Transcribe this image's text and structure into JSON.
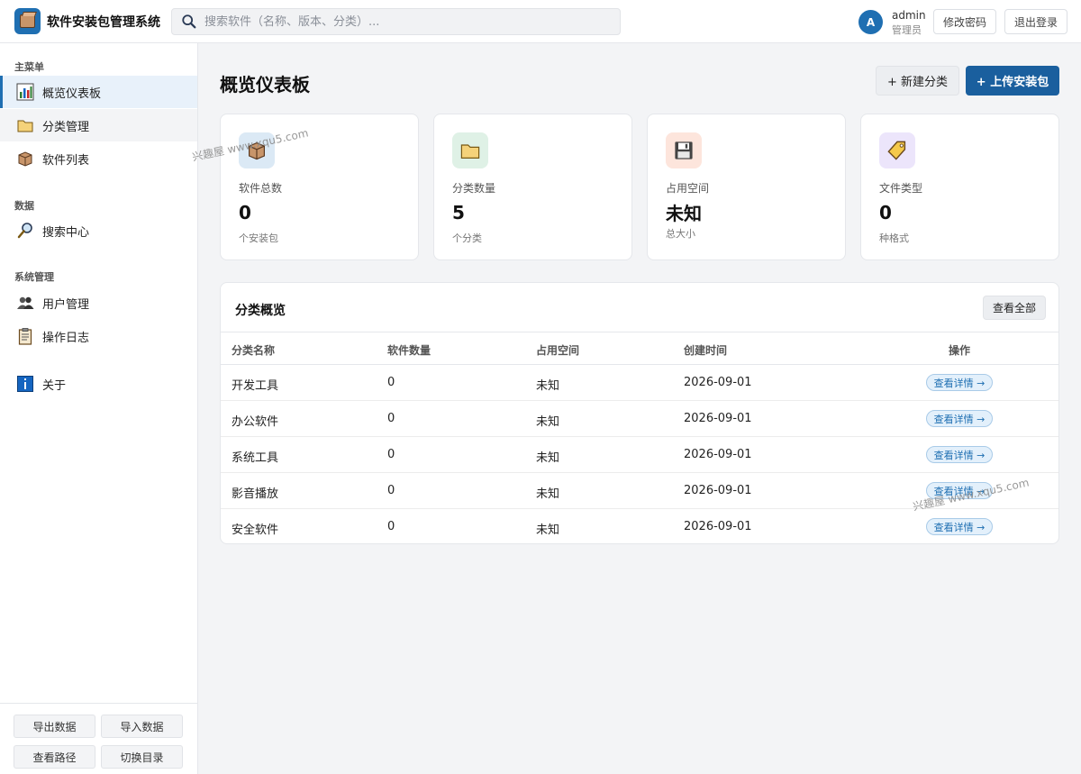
{
  "header": {
    "app_title": "软件安装包管理系统",
    "search_placeholder": "搜索软件（名称、版本、分类）...",
    "avatar_letter": "A",
    "user_name": "admin",
    "user_role": "管理员",
    "change_password": "修改密码",
    "logout": "退出登录"
  },
  "sidebar": {
    "sections": [
      {
        "title": "主菜单",
        "items": [
          {
            "label": "概览仪表板",
            "icon": "chart-icon",
            "active": true
          },
          {
            "label": "分类管理",
            "icon": "folder-icon"
          },
          {
            "label": "软件列表",
            "icon": "package-icon"
          }
        ]
      },
      {
        "title": "数据",
        "items": [
          {
            "label": "搜索中心",
            "icon": "magnifier-icon"
          }
        ]
      },
      {
        "title": "系统管理",
        "items": [
          {
            "label": "用户管理",
            "icon": "users-icon"
          },
          {
            "label": "操作日志",
            "icon": "clipboard-icon"
          },
          {
            "label": "关于",
            "icon": "info-icon"
          }
        ]
      }
    ],
    "footer": {
      "export": "导出数据",
      "import": "导入数据",
      "view_path": "查看路径",
      "switch_dir": "切换目录"
    }
  },
  "main": {
    "title": "概览仪表板",
    "new_category": "+ 新建分类",
    "upload": "+ 上传安装包",
    "stats": [
      {
        "label": "软件总数",
        "value": "0",
        "sub": "个安装包",
        "icon": "package-icon",
        "icon_bg": "#dbe9f5"
      },
      {
        "label": "分类数量",
        "value": "5",
        "sub": "个分类",
        "icon": "folder-icon",
        "icon_bg": "#dff1e6"
      },
      {
        "label": "占用空间",
        "value": "未知",
        "sub": "总大小",
        "icon": "floppy-icon",
        "icon_bg": "#fde5dc"
      },
      {
        "label": "文件类型",
        "value": "0",
        "sub": "种格式",
        "icon": "tag-icon",
        "icon_bg": "#ece5fb"
      }
    ],
    "overview": {
      "title": "分类概览",
      "view_all": "查看全部",
      "columns": [
        "分类名称",
        "软件数量",
        "占用空间",
        "创建时间",
        "操作"
      ],
      "rows": [
        {
          "name": "开发工具",
          "count": "0",
          "size": "未知",
          "created": "2026-09-01",
          "action": "查看详情 →"
        },
        {
          "name": "办公软件",
          "count": "0",
          "size": "未知",
          "created": "2026-09-01",
          "action": "查看详情 →"
        },
        {
          "name": "系统工具",
          "count": "0",
          "size": "未知",
          "created": "2026-09-01",
          "action": "查看详情 →"
        },
        {
          "name": "影音播放",
          "count": "0",
          "size": "未知",
          "created": "2026-09-01",
          "action": "查看详情 →"
        },
        {
          "name": "安全软件",
          "count": "0",
          "size": "未知",
          "created": "2026-09-01",
          "action": "查看详情 →"
        }
      ]
    }
  },
  "watermark": "兴趣屋 www.xqu5.com",
  "colors": {
    "accent": "#1f6fb2",
    "primary_button": "#1a5f9e"
  }
}
